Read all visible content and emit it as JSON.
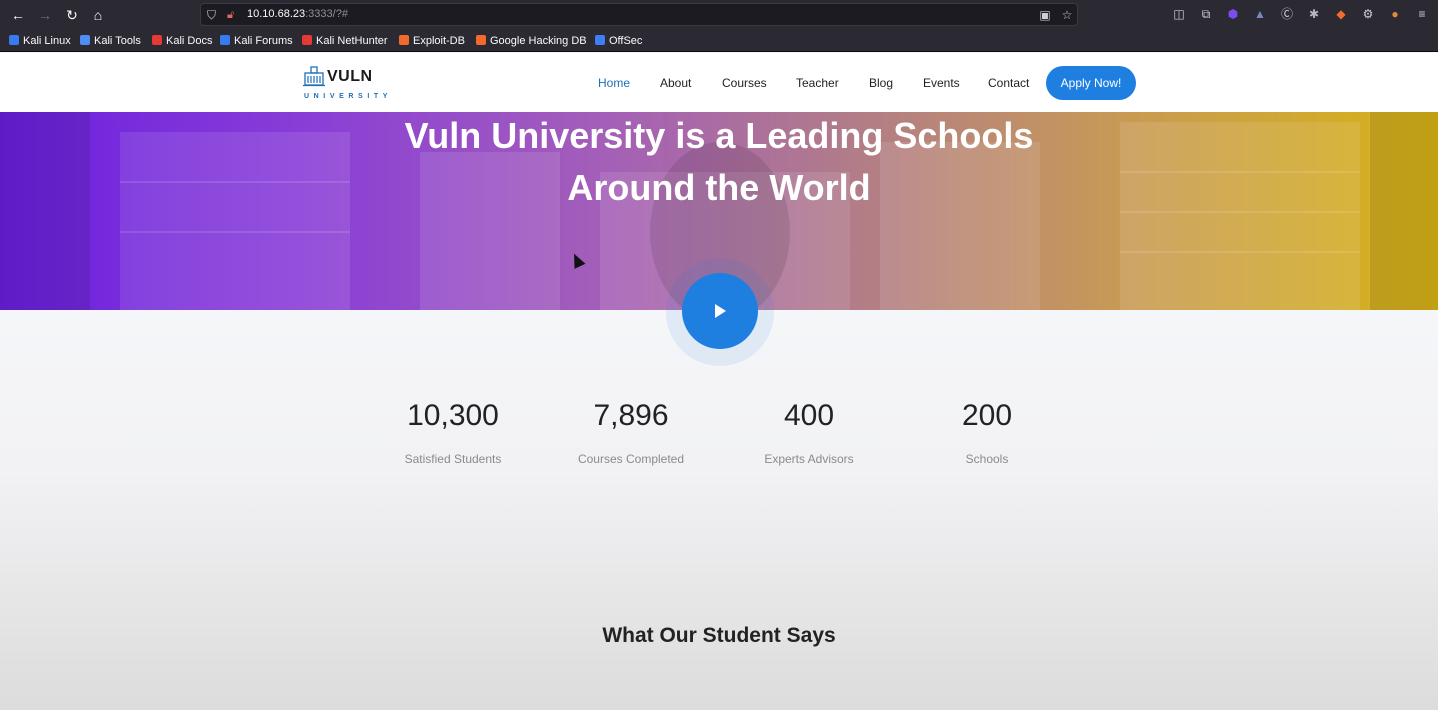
{
  "browser": {
    "url_host": "10.10.68.23",
    "url_rest": ":3333/?#",
    "bookmarks": [
      {
        "label": "Kali Linux",
        "color": "#367bf0"
      },
      {
        "label": "Kali Tools",
        "color": "#4f8df5"
      },
      {
        "label": "Kali Docs",
        "color": "#e53935"
      },
      {
        "label": "Kali Forums",
        "color": "#367bf0"
      },
      {
        "label": "Kali NetHunter",
        "color": "#e53935"
      },
      {
        "label": "Exploit-DB",
        "color": "#f26a2e"
      },
      {
        "label": "Google Hacking DB",
        "color": "#f26a2e"
      },
      {
        "label": "OffSec",
        "color": "#3d7ff5"
      }
    ]
  },
  "site": {
    "logo_word": "VULN",
    "logo_sub": "UNIVERSITY",
    "nav": {
      "home": "Home",
      "about": "About",
      "courses": "Courses",
      "teacher": "Teacher",
      "blog": "Blog",
      "events": "Events",
      "contact": "Contact"
    },
    "apply_label": "Apply Now!",
    "accent_color": "#1e7fe0"
  },
  "hero": {
    "title_line1": "Vuln University is a Leading Schools",
    "title_line2": "Around the World"
  },
  "stats": [
    {
      "number": "10,300",
      "label": "Satisfied Students"
    },
    {
      "number": "7,896",
      "label": "Courses Completed"
    },
    {
      "number": "400",
      "label": "Experts Advisors"
    },
    {
      "number": "200",
      "label": "Schools"
    }
  ],
  "testimonials": {
    "title": "What Our Student Says"
  }
}
